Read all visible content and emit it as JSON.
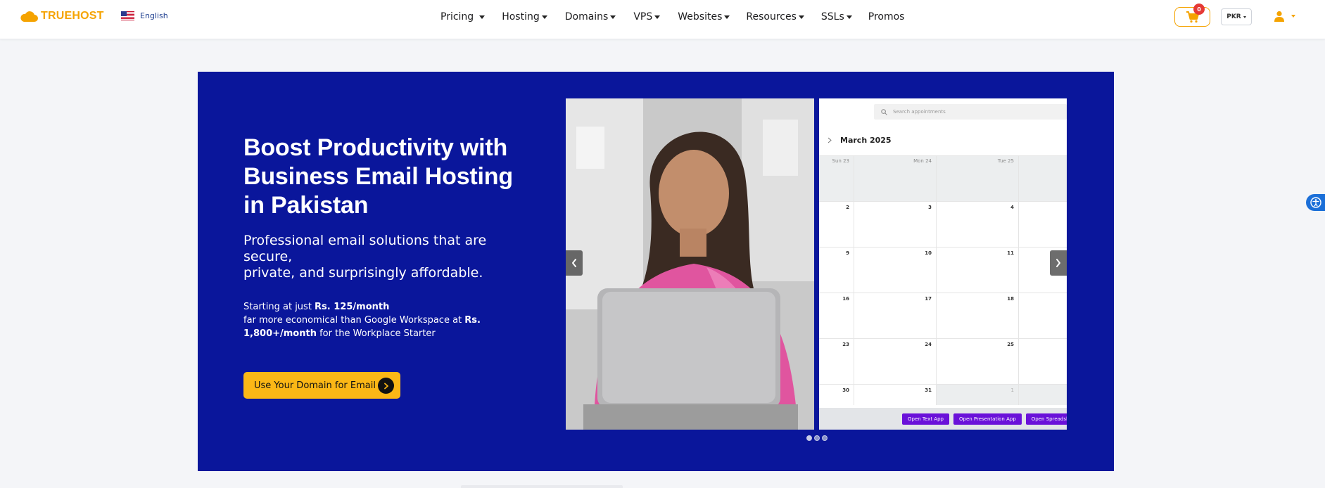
{
  "header": {
    "brand": "TRUEHOST",
    "language": "English",
    "nav": [
      {
        "label": "Pricing",
        "name": "nav-pricing"
      },
      {
        "label": "Hosting",
        "name": "nav-hosting"
      },
      {
        "label": "Domains",
        "name": "nav-domains"
      },
      {
        "label": "VPS",
        "name": "nav-vps"
      },
      {
        "label": "Websites",
        "name": "nav-websites"
      },
      {
        "label": "Resources",
        "name": "nav-resources"
      },
      {
        "label": "SSLs",
        "name": "nav-ssls"
      },
      {
        "label": "Promos",
        "name": "nav-promos"
      }
    ],
    "cart_count": "0",
    "currency": "PKR"
  },
  "hero": {
    "title": "Boost Productivity with Business Email Hosting in Pakistan",
    "subtitle_line1": "Professional email solutions that are secure,",
    "subtitle_line2": "private, and surprisingly affordable.",
    "price_prefix": "Starting at just ",
    "price_value": "Rs. 125/month",
    "compare_prefix": "far more economical than Google Workspace at ",
    "compare_value": "Rs. 1,800+/month",
    "compare_suffix": " for the Workplace Starter",
    "cta_label": "Use Your Domain for Email"
  },
  "slider": {
    "active_slide": 1,
    "slide_count": 3,
    "calendar": {
      "search_placeholder": "Search appointments",
      "month": "March 2025",
      "day_headers": [
        "Sun 23",
        "Mon 24",
        "Tue 25"
      ],
      "rows": [
        [
          "",
          "",
          "",
          ""
        ],
        [
          "2",
          "3",
          "4",
          ""
        ],
        [
          "9",
          "10",
          "11",
          ""
        ],
        [
          "16",
          "17",
          "18",
          ""
        ],
        [
          "23",
          "24",
          "25",
          ""
        ],
        [
          "30",
          "31",
          "1",
          ""
        ]
      ],
      "buttons": [
        "Open Text App",
        "Open Presentation App",
        "Open Spreadsheet App"
      ]
    }
  },
  "colors": {
    "brand_orange": "#f5a300",
    "hero_blue": "#0a169b",
    "cta_yellow": "#fbb716",
    "calendar_button": "#6a11d9"
  },
  "icons": {
    "logo": "cloud-icon",
    "cart": "cart-icon",
    "user": "user-icon",
    "accessibility": "accessibility-icon",
    "cta": "arrow-right-icon",
    "slider_prev": "chevron-left-icon",
    "slider_next": "chevron-right-icon"
  }
}
